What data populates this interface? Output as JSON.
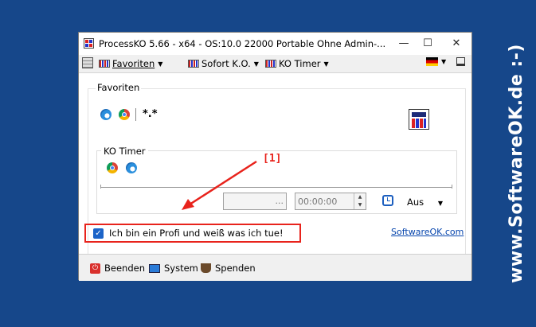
{
  "window": {
    "title": "ProcessKO 5.66 - x64  - OS:10.0 22000 Portable Ohne Admin-...",
    "minimize": "—",
    "maximize": "☐",
    "close": "✕"
  },
  "menu": {
    "items": [
      {
        "label": "Favoriten"
      },
      {
        "label": "Sofort K.O."
      },
      {
        "label": "KO Timer"
      }
    ],
    "caret": "▼"
  },
  "favoriten": {
    "title": "Favoriten",
    "pattern": "*.*"
  },
  "ko_timer": {
    "title": "KO Timer",
    "ellipsis": "...",
    "time": "00:00:00",
    "mode": "Aus",
    "caret": "▼"
  },
  "checkbox": {
    "label": "Ich bin ein Profi und weiß was ich tue!",
    "checked": "✓"
  },
  "link": {
    "label": "SoftwareOK.com"
  },
  "footer": {
    "beenden": "Beenden",
    "system": "System",
    "spenden": "Spenden"
  },
  "annotation": {
    "label": "[1]"
  },
  "watermark": {
    "text": "www.SoftwareOK.de :-)"
  },
  "colors": {
    "background": "#16478a",
    "highlight": "#e8231c",
    "link": "#0645ad",
    "checkbox": "#1c64c8"
  }
}
